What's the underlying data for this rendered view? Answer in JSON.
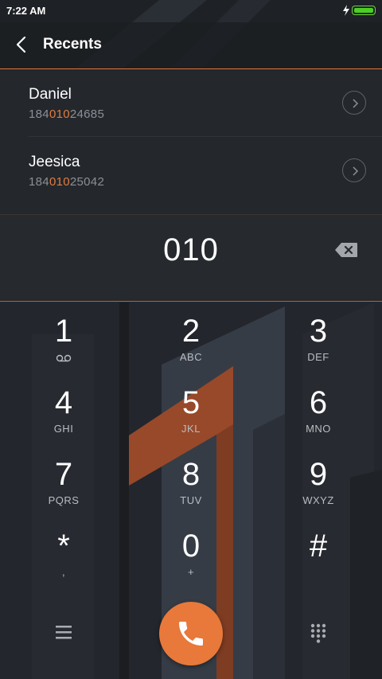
{
  "status_bar": {
    "time": "7:22 AM"
  },
  "header": {
    "title": "Recents"
  },
  "recents": [
    {
      "name": "Daniel",
      "number_prefix": "184",
      "number_match": "010",
      "number_suffix": "24685"
    },
    {
      "name": "Jeesica",
      "number_prefix": "184",
      "number_match": "010",
      "number_suffix": "25042"
    }
  ],
  "dial": {
    "entered": "010"
  },
  "keypad": [
    {
      "digit": "1",
      "letters": ""
    },
    {
      "digit": "2",
      "letters": "ABC"
    },
    {
      "digit": "3",
      "letters": "DEF"
    },
    {
      "digit": "4",
      "letters": "GHI"
    },
    {
      "digit": "5",
      "letters": "JKL"
    },
    {
      "digit": "6",
      "letters": "MNO"
    },
    {
      "digit": "7",
      "letters": "PQRS"
    },
    {
      "digit": "8",
      "letters": "TUV"
    },
    {
      "digit": "9",
      "letters": "WXYZ"
    },
    {
      "digit": "*",
      "letters": ","
    },
    {
      "digit": "0",
      "letters": "+"
    },
    {
      "digit": "#",
      "letters": ""
    }
  ],
  "icons": {
    "back": "back-arrow-icon",
    "detail": "chevron-right-icon",
    "backspace": "backspace-icon",
    "voicemail": "voicemail-icon",
    "menu": "menu-icon",
    "call": "phone-icon",
    "dialpad": "dialpad-icon"
  },
  "colors": {
    "accent": "#e8793a",
    "background": "#23262c",
    "highlight": "#e17c3f",
    "battery": "#4ccf24"
  }
}
